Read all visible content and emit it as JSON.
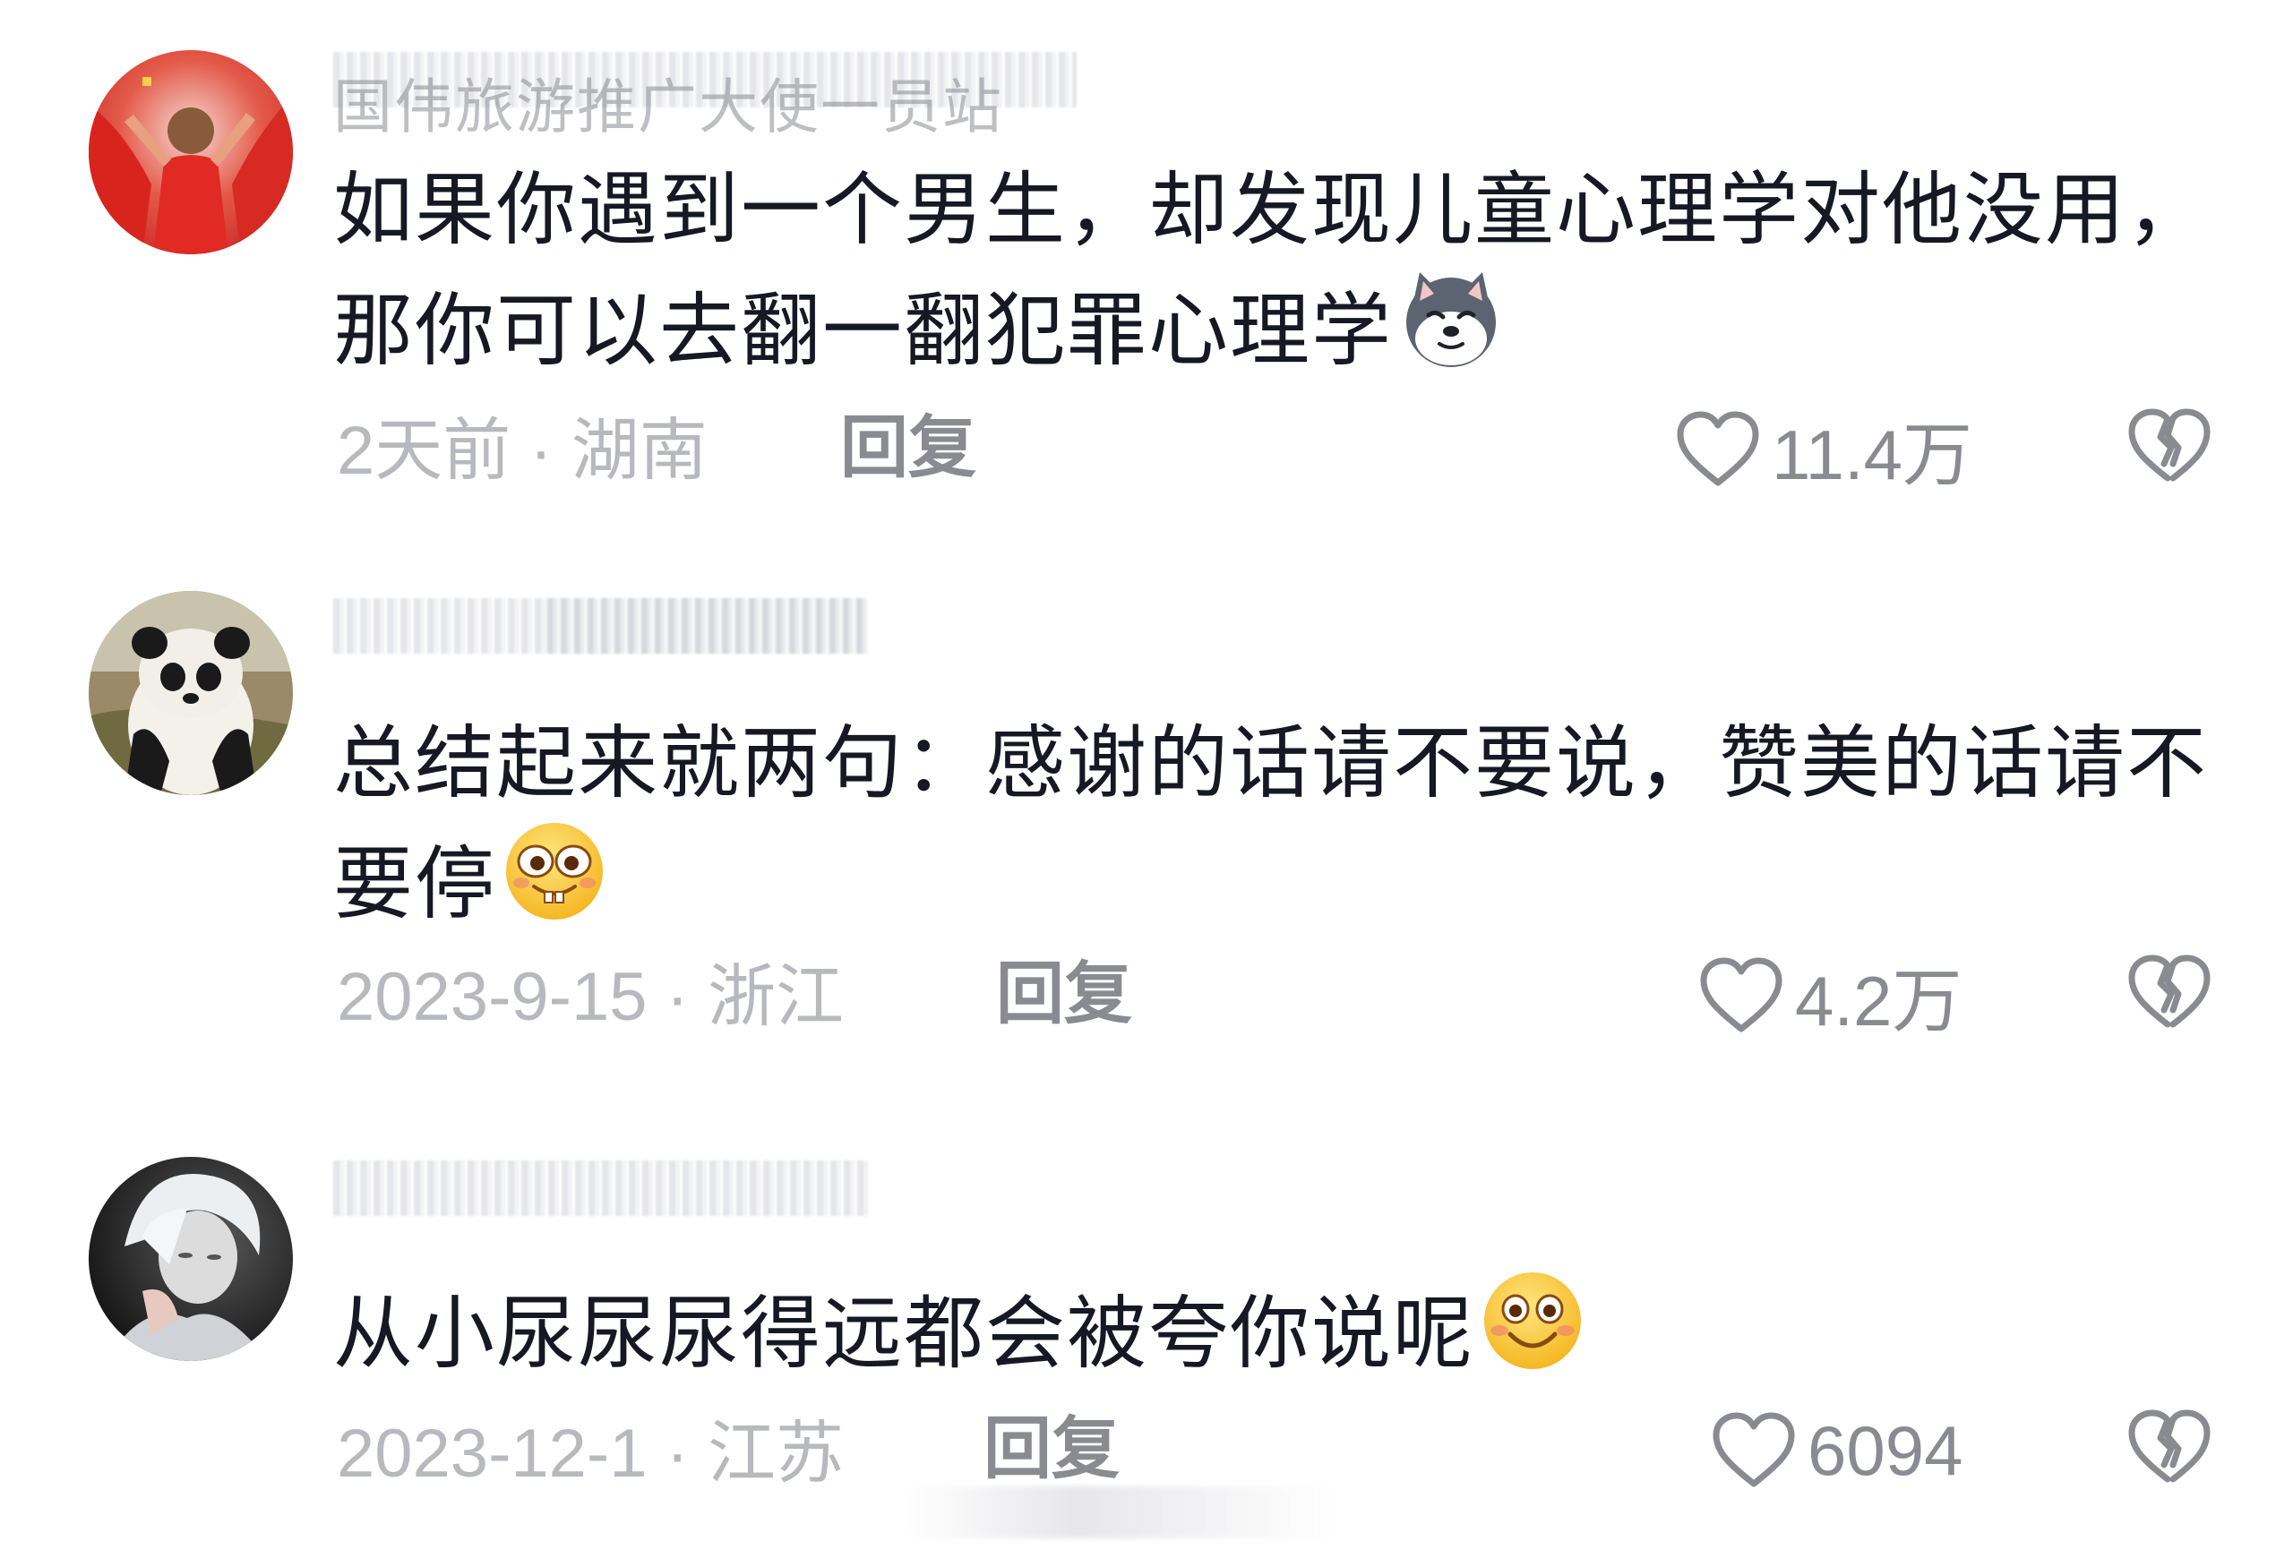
{
  "comments": [
    {
      "username": "国伟旅游推广大使一员站",
      "text": "如果你遇到一个男生，却发现儿童心理学对他没用，那你可以去翻一翻犯罪心理学",
      "emoji": "husky-dog-emoji",
      "meta": "2天前 · 湖南",
      "reply": "回复",
      "likes": "11.4万"
    },
    {
      "username": "",
      "text": "总结起来就两句：感谢的话请不要说，赞美的话请不要停",
      "emoji": "goofy-grin-emoji",
      "meta": "2023-9-15 · 浙江",
      "reply": "回复",
      "likes": "4.2万"
    },
    {
      "username": "",
      "text": "从小尿尿尿得远都会被夸你说呢",
      "emoji": "smile-emoji",
      "meta": "2023-12-1 · 江苏",
      "reply": "回复",
      "likes": "6094"
    }
  ],
  "colors": {
    "text": "#161823",
    "meta": "#b8b9be",
    "action": "#8a8b91"
  }
}
